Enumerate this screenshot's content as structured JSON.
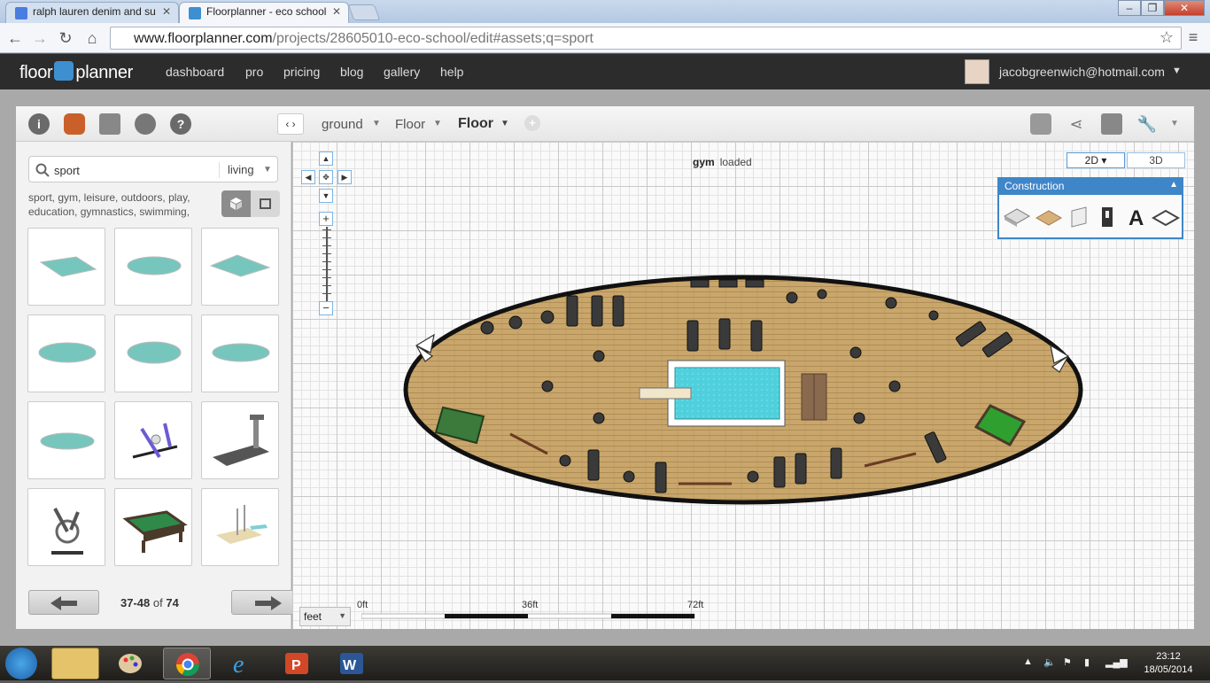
{
  "browser": {
    "tabs": [
      {
        "title": "ralph lauren denim and su"
      },
      {
        "title": "Floorplanner - eco school"
      }
    ],
    "url_host": "www.floorplanner.com",
    "url_path": "/projects/28605010-eco-school/edit#assets;q=sport"
  },
  "app": {
    "logo_left": "floor",
    "logo_right": "planner",
    "nav": [
      "dashboard",
      "pro",
      "pricing",
      "blog",
      "gallery",
      "help"
    ],
    "user_email": "jacobgreenwich@hotmail.com"
  },
  "toolbar": {
    "level": "ground",
    "floor1": "Floor",
    "floor2": "Floor"
  },
  "sidebar": {
    "search_value": "sport",
    "category": "living",
    "tags": "sport, gym, leisure, outdoors, play, education, gymnastics, swimming,",
    "items": [
      "pool-1",
      "pool-2",
      "pool-3",
      "pool-4",
      "pool-5",
      "pool-6",
      "pool-7",
      "cross-trainer",
      "treadmill",
      "exercise-bike",
      "pool-table",
      "pool-ladder"
    ],
    "pager": {
      "range": "37-48",
      "of": "of",
      "total": "74"
    }
  },
  "canvas": {
    "status_name": "gym",
    "status_text": "loaded",
    "mode_2d": "2D ▾",
    "mode_3d": "3D",
    "construction_title": "Construction",
    "unit": "feet",
    "scale_labels": [
      "0ft",
      "36ft",
      "72ft"
    ]
  },
  "taskbar": {
    "time": "23:12",
    "date": "18/05/2014"
  },
  "colors": {
    "app_nav_bg": "#2c2c2c",
    "accent_blue": "#3f86c9",
    "wood_floor": "#c9a66b",
    "pool_water": "#4fd0dc"
  }
}
